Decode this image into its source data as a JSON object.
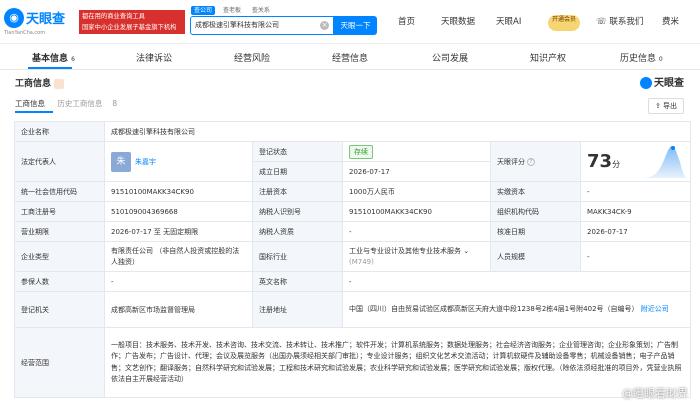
{
  "header": {
    "logo_text": "天眼查",
    "logo_sub": "TianYanCha.com",
    "slogan_line1": "都在用的商业查询工具",
    "slogan_line2": "国家中小企业发展子基金旗下机构",
    "search_tabs": [
      "查公司",
      "查老板",
      "查关系"
    ],
    "search_value": "成都极速引擎科技有限公司",
    "search_button": "天眼一下",
    "nav": [
      "首页",
      "天眼数据",
      "天眼AI"
    ],
    "vip_label": "开通会员",
    "contact": "联系我们",
    "user": "费米"
  },
  "subnav": [
    "基本信息",
    "法律诉讼",
    "经营风险",
    "经营信息",
    "公司发展",
    "知识产权",
    "历史信息"
  ],
  "subnav_counts": {
    "basic": "6",
    "history": "0"
  },
  "section": {
    "title": "工商信息",
    "brand": "天眼查",
    "tabs": [
      "工商信息",
      "历史工商信息"
    ],
    "history_count": "8",
    "export": "导出"
  },
  "table": {
    "company_name_label": "企业名称",
    "company_name": "成都极速引擎科技有限公司",
    "legal_rep_label": "法定代表人",
    "legal_rep_avatar": "朱",
    "legal_rep": "朱嘉宇",
    "reg_status_label": "登记状态",
    "reg_status": "存续",
    "est_date_label": "成立日期",
    "est_date": "2026-07-17",
    "score_label": "天眼评分",
    "score": "73",
    "score_unit": "分",
    "credit_code_label": "统一社会信用代码",
    "credit_code": "91510100MAKK34CK90",
    "reg_capital_label": "注册资本",
    "reg_capital": "1000万人民币",
    "paid_capital_label": "实缴资本",
    "paid_capital": "-",
    "reg_no_label": "工商注册号",
    "reg_no": "510109004369668",
    "tax_id_label": "纳税人识别号",
    "tax_id": "91510100MAKK34CK90",
    "org_code_label": "组织机构代码",
    "org_code": "MAKK34CK-9",
    "term_label": "营业期限",
    "term": "2026-07-17 至 无固定期限",
    "tax_qual_label": "纳税人资质",
    "tax_qual": "-",
    "approve_date_label": "核准日期",
    "approve_date": "2026-07-17",
    "type_label": "企业类型",
    "type": "有限责任公司 （非自然人投资或控股的法人独资）",
    "industry_label": "国标行业",
    "industry": "工业与专业设计及其他专业技术服务",
    "industry_code": "(M749)",
    "staff_label": "人员规模",
    "staff": "-",
    "insured_label": "参保人数",
    "insured": "-",
    "en_name_label": "英文名称",
    "en_name": "-",
    "authority_label": "登记机关",
    "authority": "成都高新区市场监督管理局",
    "address_label": "注册地址",
    "address": "中国（四川）自由贸易试验区成都高新区天府大道中段1238号2栋4层1号附402号（自编号）",
    "nearby": "附近公司",
    "scope_label": "经营范围",
    "scope": "一般项目：技术服务、技术开发、技术咨询、技术交流、技术转让、技术推广；软件开发；计算机系统服务；数据处理服务；社会经济咨询服务；企业管理咨询；企业形象策划；广告制作；广告发布；广告设计、代理；会议及展览服务（出国办展须经相关部门审批）；专业设计服务；组织文化艺术交流活动；计算机软硬件及辅助设备零售；机械设备销售；电子产品销售；文艺创作；翻译服务；自然科学研究和试验发展；工程和技术研究和试验发展；农业科学研究和试验发展；医学研究和试验发展；版权代理。（除依法须经批准的项目外，凭营业执照依法自主开展经营活动）"
  },
  "watermark": "@瞪眼看財界"
}
